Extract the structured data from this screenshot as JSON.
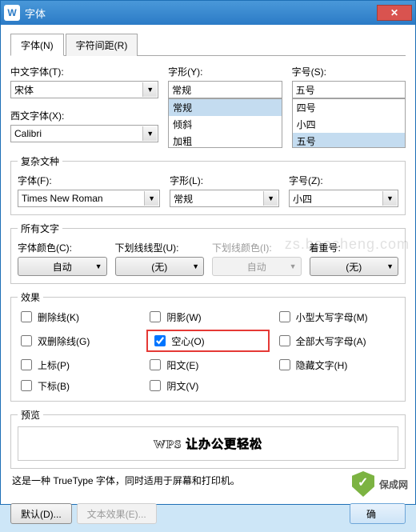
{
  "window": {
    "title": "字体"
  },
  "tabs": {
    "font": "字体(N)",
    "spacing": "字符间距(R)"
  },
  "top": {
    "zhFontLabel": "中文字体(T):",
    "zhFont": "宋体",
    "enFontLabel": "西文字体(X):",
    "enFont": "Calibri",
    "styleLabel": "字形(Y):",
    "style": "常规",
    "styleOptions": [
      "常规",
      "倾斜",
      "加粗"
    ],
    "sizeLabel": "字号(S):",
    "size": "五号",
    "sizeOptions": [
      "四号",
      "小四",
      "五号"
    ]
  },
  "complex": {
    "legend": "复杂文种",
    "fontLabel": "字体(F):",
    "font": "Times New Roman",
    "styleLabel": "字形(L):",
    "style": "常规",
    "sizeLabel": "字号(Z):",
    "size": "小四"
  },
  "all": {
    "legend": "所有文字",
    "colorLabel": "字体颜色(C):",
    "color": "自动",
    "ulineLabel": "下划线线型(U):",
    "uline": "(无)",
    "ucolorLabel": "下划线颜色(I):",
    "ucolor": "自动",
    "emphLabel": "着重号:",
    "emph": "(无)"
  },
  "effects": {
    "legend": "效果",
    "strike": "删除线(K)",
    "dblstrike": "双删除线(G)",
    "super": "上标(P)",
    "sub": "下标(B)",
    "shadow": "阴影(W)",
    "outline": "空心(O)",
    "emboss": "阳文(E)",
    "engrave": "阴文(V)",
    "smallcaps": "小型大写字母(M)",
    "allcaps": "全部大写字母(A)",
    "hidden": "隐藏文字(H)"
  },
  "preview": {
    "legend": "预览",
    "text": "WPS 让办公更轻松"
  },
  "note": "这是一种 TrueType 字体，同时适用于屏幕和打印机。",
  "buttons": {
    "default": "默认(D)...",
    "textfx": "文本效果(E)...",
    "ok": "确",
    "cancel": ""
  },
  "watermark": {
    "logo": "保成网",
    "url": "zs.baocheng.com"
  }
}
